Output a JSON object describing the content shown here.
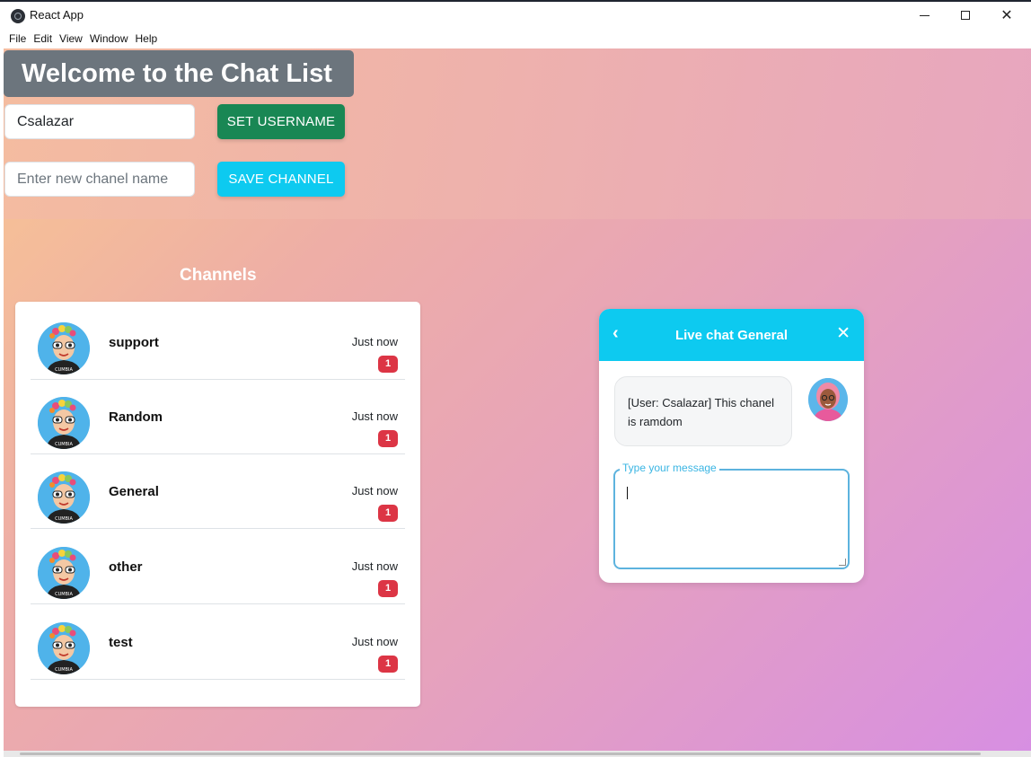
{
  "window": {
    "title": "React App",
    "minimize_glyph": "—",
    "maximize_glyph": "☐",
    "close_glyph": "✕"
  },
  "menu": [
    "File",
    "Edit",
    "View",
    "Window",
    "Help"
  ],
  "header": {
    "welcome": "Welcome to the Chat List"
  },
  "forms": {
    "username_value": "Csalazar",
    "username_button": "SET USERNAME",
    "channel_placeholder": "Enter new chanel name",
    "channel_button": "SAVE CHANNEL"
  },
  "channels": {
    "heading": "Channels",
    "items": [
      {
        "name": "support",
        "time": "Just now",
        "count": "1"
      },
      {
        "name": "Random",
        "time": "Just now",
        "count": "1"
      },
      {
        "name": "General",
        "time": "Just now",
        "count": "1"
      },
      {
        "name": "other",
        "time": "Just now",
        "count": "1"
      },
      {
        "name": "test",
        "time": "Just now",
        "count": "1"
      }
    ]
  },
  "chat": {
    "back_glyph": "‹",
    "title": "Live chat General",
    "close_glyph": "✕",
    "message": "[User: Csalazar] This chanel is ramdom",
    "input_label": "Type your message"
  },
  "colors": {
    "success": "#198754",
    "info": "#0dcaf0",
    "secondary": "#6c757d",
    "danger": "#dc3545"
  }
}
